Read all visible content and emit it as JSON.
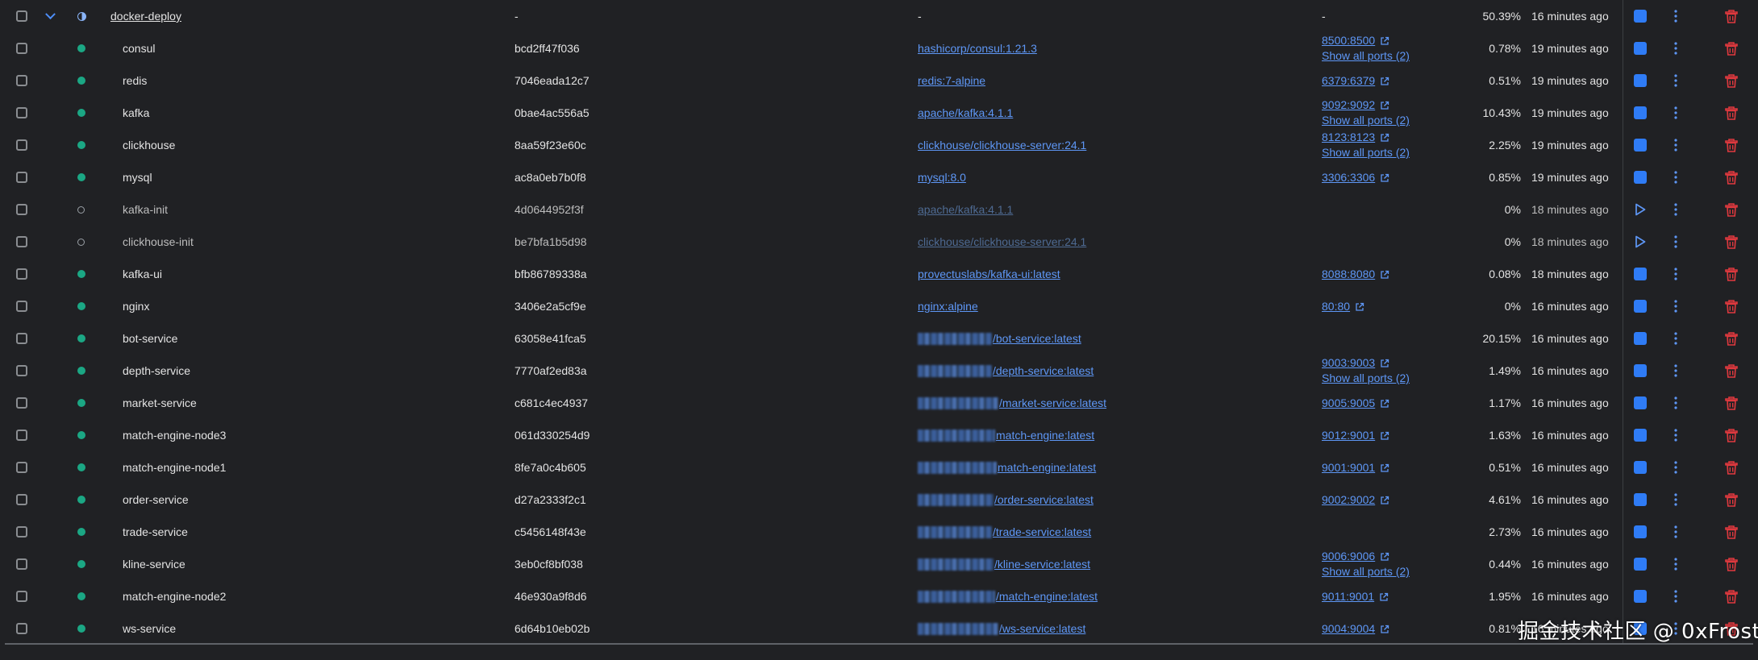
{
  "colors": {
    "background": "#202124",
    "running": "#1ba784",
    "link": "#5e97f6",
    "stop_button": "#2f7cf6",
    "delete": "#e0393e"
  },
  "icons": {
    "expand": "chevron-down-icon",
    "group_status": "half-circle-icon",
    "running": "green-dot-icon",
    "exited": "hollow-circle-icon",
    "external_link": "external-link-icon",
    "stop": "stop-square-icon",
    "start": "play-icon",
    "more": "vertical-dots-icon",
    "delete": "trash-icon"
  },
  "group": {
    "name": "docker-deploy",
    "id": "-",
    "image": "-",
    "port": "-",
    "cpu": "50.39%",
    "time": "16 minutes ago"
  },
  "containers": [
    {
      "name": "consul",
      "status": "running",
      "id": "bcd2ff47f036",
      "image": "hashicorp/consul:1.21.3",
      "image_blurred": false,
      "ports": [
        "8500:8500"
      ],
      "show_all": "Show all ports (2)",
      "cpu": "0.78%",
      "time": "19 minutes ago"
    },
    {
      "name": "redis",
      "status": "running",
      "id": "7046eada12c7",
      "image": "redis:7-alpine",
      "image_blurred": false,
      "ports": [
        "6379:6379"
      ],
      "show_all": "",
      "cpu": "0.51%",
      "time": "19 minutes ago"
    },
    {
      "name": "kafka",
      "status": "running",
      "id": "0bae4ac556a5",
      "image": "apache/kafka:4.1.1",
      "image_blurred": false,
      "ports": [
        "9092:9092"
      ],
      "show_all": "Show all ports (2)",
      "cpu": "10.43%",
      "time": "19 minutes ago"
    },
    {
      "name": "clickhouse",
      "status": "running",
      "id": "8aa59f23e60c",
      "image": "clickhouse/clickhouse-server:24.1",
      "image_blurred": false,
      "ports": [
        "8123:8123"
      ],
      "show_all": "Show all ports (2)",
      "cpu": "2.25%",
      "time": "19 minutes ago"
    },
    {
      "name": "mysql",
      "status": "running",
      "id": "ac8a0eb7b0f8",
      "image": "mysql:8.0",
      "image_blurred": false,
      "ports": [
        "3306:3306"
      ],
      "show_all": "",
      "cpu": "0.85%",
      "time": "19 minutes ago"
    },
    {
      "name": "kafka-init",
      "status": "exited",
      "id": "4d0644952f3f",
      "image": "apache/kafka:4.1.1",
      "image_blurred": false,
      "ports": [],
      "show_all": "",
      "cpu": "0%",
      "time": "18 minutes ago"
    },
    {
      "name": "clickhouse-init",
      "status": "exited",
      "id": "be7bfa1b5d98",
      "image": "clickhouse/clickhouse-server:24.1",
      "image_blurred": false,
      "ports": [],
      "show_all": "",
      "cpu": "0%",
      "time": "18 minutes ago"
    },
    {
      "name": "kafka-ui",
      "status": "running",
      "id": "bfb86789338a",
      "image": "provectuslabs/kafka-ui:latest",
      "image_blurred": false,
      "ports": [
        "8088:8080"
      ],
      "show_all": "",
      "cpu": "0.08%",
      "time": "18 minutes ago"
    },
    {
      "name": "nginx",
      "status": "running",
      "id": "3406e2a5cf9e",
      "image": "nginx:alpine",
      "image_blurred": false,
      "ports": [
        "80:80"
      ],
      "show_all": "",
      "cpu": "0%",
      "time": "16 minutes ago"
    },
    {
      "name": "bot-service",
      "status": "running",
      "id": "63058e41fca5",
      "image": "/bot-service:latest",
      "image_blurred": true,
      "ports": [],
      "show_all": "",
      "cpu": "20.15%",
      "time": "16 minutes ago"
    },
    {
      "name": "depth-service",
      "status": "running",
      "id": "7770af2ed83a",
      "image": "/depth-service:latest",
      "image_blurred": true,
      "ports": [
        "9003:9003"
      ],
      "show_all": "Show all ports (2)",
      "cpu": "1.49%",
      "time": "16 minutes ago"
    },
    {
      "name": "market-service",
      "status": "running",
      "id": "c681c4ec4937",
      "image": "/market-service:latest",
      "image_blurred": true,
      "ports": [
        "9005:9005"
      ],
      "show_all": "",
      "cpu": "1.17%",
      "time": "16 minutes ago"
    },
    {
      "name": "match-engine-node3",
      "status": "running",
      "id": "061d330254d9",
      "image": "match-engine:latest",
      "image_blurred": true,
      "ports": [
        "9012:9001"
      ],
      "show_all": "",
      "cpu": "1.63%",
      "time": "16 minutes ago"
    },
    {
      "name": "match-engine-node1",
      "status": "running",
      "id": "8fe7a0c4b605",
      "image": "match-engine:latest",
      "image_blurred": true,
      "ports": [
        "9001:9001"
      ],
      "show_all": "",
      "cpu": "0.51%",
      "time": "16 minutes ago"
    },
    {
      "name": "order-service",
      "status": "running",
      "id": "d27a2333f2c1",
      "image": "/order-service:latest",
      "image_blurred": true,
      "ports": [
        "9002:9002"
      ],
      "show_all": "",
      "cpu": "4.61%",
      "time": "16 minutes ago"
    },
    {
      "name": "trade-service",
      "status": "running",
      "id": "c5456148f43e",
      "image": "/trade-service:latest",
      "image_blurred": true,
      "ports": [],
      "show_all": "",
      "cpu": "2.73%",
      "time": "16 minutes ago"
    },
    {
      "name": "kline-service",
      "status": "running",
      "id": "3eb0cf8bf038",
      "image": "/kline-service:latest",
      "image_blurred": true,
      "ports": [
        "9006:9006"
      ],
      "show_all": "Show all ports (2)",
      "cpu": "0.44%",
      "time": "16 minutes ago"
    },
    {
      "name": "match-engine-node2",
      "status": "running",
      "id": "46e930a9f8d6",
      "image": "/match-engine:latest",
      "image_blurred": true,
      "ports": [
        "9011:9001"
      ],
      "show_all": "",
      "cpu": "1.95%",
      "time": "16 minutes ago"
    },
    {
      "name": "ws-service",
      "status": "running",
      "id": "6d64b10eb02b",
      "image": "/ws-service:latest",
      "image_blurred": true,
      "ports": [
        "9004:9004"
      ],
      "show_all": "",
      "cpu": "0.81%",
      "time": "16 minutes ago"
    }
  ],
  "watermark": "掘金技术社区 @ 0xFrost"
}
